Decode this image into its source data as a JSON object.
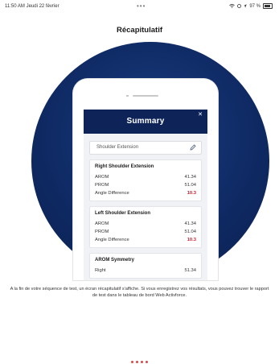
{
  "status_bar": {
    "time": "11:50 AM  Jeudi 22 février",
    "dots": "•••",
    "battery": "97 %"
  },
  "page": {
    "title": "Récapitulatif"
  },
  "summary_screen": {
    "header_title": "Summary",
    "close_label": "✕",
    "test_name": "Shoulder Extension",
    "cards": [
      {
        "title": "Right Shoulder Extension",
        "rows": [
          {
            "label": "AROM",
            "value": "41.34",
            "alert": false
          },
          {
            "label": "PROM",
            "value": "51.04",
            "alert": false
          },
          {
            "label": "Angle Difference",
            "value": "10.3",
            "alert": true
          }
        ]
      },
      {
        "title": "Left Shoulder Extension",
        "rows": [
          {
            "label": "AROM",
            "value": "41.34",
            "alert": false
          },
          {
            "label": "PROM",
            "value": "51.04",
            "alert": false
          },
          {
            "label": "Angle Difference",
            "value": "10.3",
            "alert": true
          }
        ]
      },
      {
        "title": "AROM Symmetry",
        "rows": [
          {
            "label": "Right",
            "value": "51.34",
            "alert": false
          }
        ]
      }
    ]
  },
  "caption": "A la fin de votre séquence de test, un écran récapitulatif s'affiche. Si vous enregistrez vos résultats, vous pouvez trouver le rapport de test dans le tableau de bord Web Activforce.",
  "colors": {
    "navy": "#0e2459",
    "circle": "#0f2a64",
    "alert": "#d0202c",
    "pager": "#d44a4a"
  }
}
